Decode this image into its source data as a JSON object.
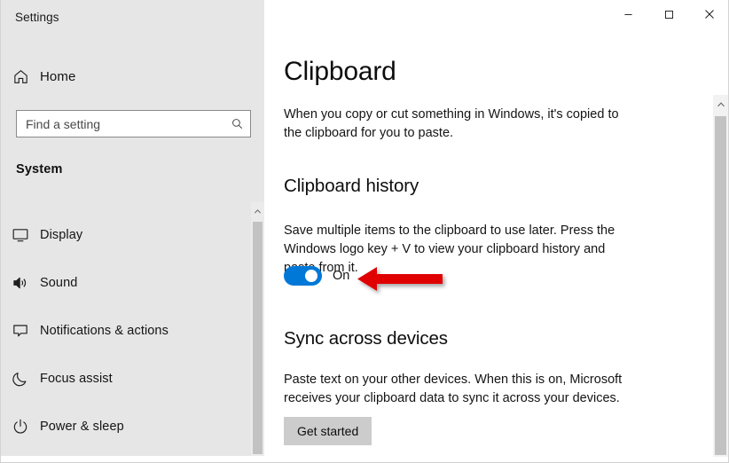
{
  "window": {
    "app_title": "Settings",
    "controls": {
      "minimize": "minimize-button",
      "maximize": "maximize-button",
      "close": "close-button"
    }
  },
  "sidebar": {
    "home_label": "Home",
    "search": {
      "placeholder": "Find a setting",
      "value": ""
    },
    "section_label": "System",
    "items": [
      {
        "label": "Display",
        "icon": "monitor-icon"
      },
      {
        "label": "Sound",
        "icon": "speaker-icon"
      },
      {
        "label": "Notifications & actions",
        "icon": "speech-bubble-icon"
      },
      {
        "label": "Focus assist",
        "icon": "moon-icon"
      },
      {
        "label": "Power & sleep",
        "icon": "power-icon"
      }
    ]
  },
  "main": {
    "page_title": "Clipboard",
    "intro_text": "When you copy or cut something in Windows, it's copied to the clipboard for you to paste.",
    "clipboard_history": {
      "heading": "Clipboard history",
      "description": "Save multiple items to the clipboard to use later. Press the Windows logo key + V to view your clipboard history and paste from it.",
      "toggle_state": "On"
    },
    "sync_across_devices": {
      "heading": "Sync across devices",
      "description": "Paste text on your other devices. When this is on, Microsoft receives your clipboard data to sync it across your devices.",
      "button_label": "Get started"
    }
  },
  "annotation": {
    "arrow": "red-left-arrow",
    "color": "#e00000"
  },
  "colors": {
    "accent": "#0078d7",
    "sidebar_bg": "#e6e6e6",
    "main_bg": "#ffffff",
    "button_bg": "#cccccc",
    "annotation_red": "#e00000"
  }
}
